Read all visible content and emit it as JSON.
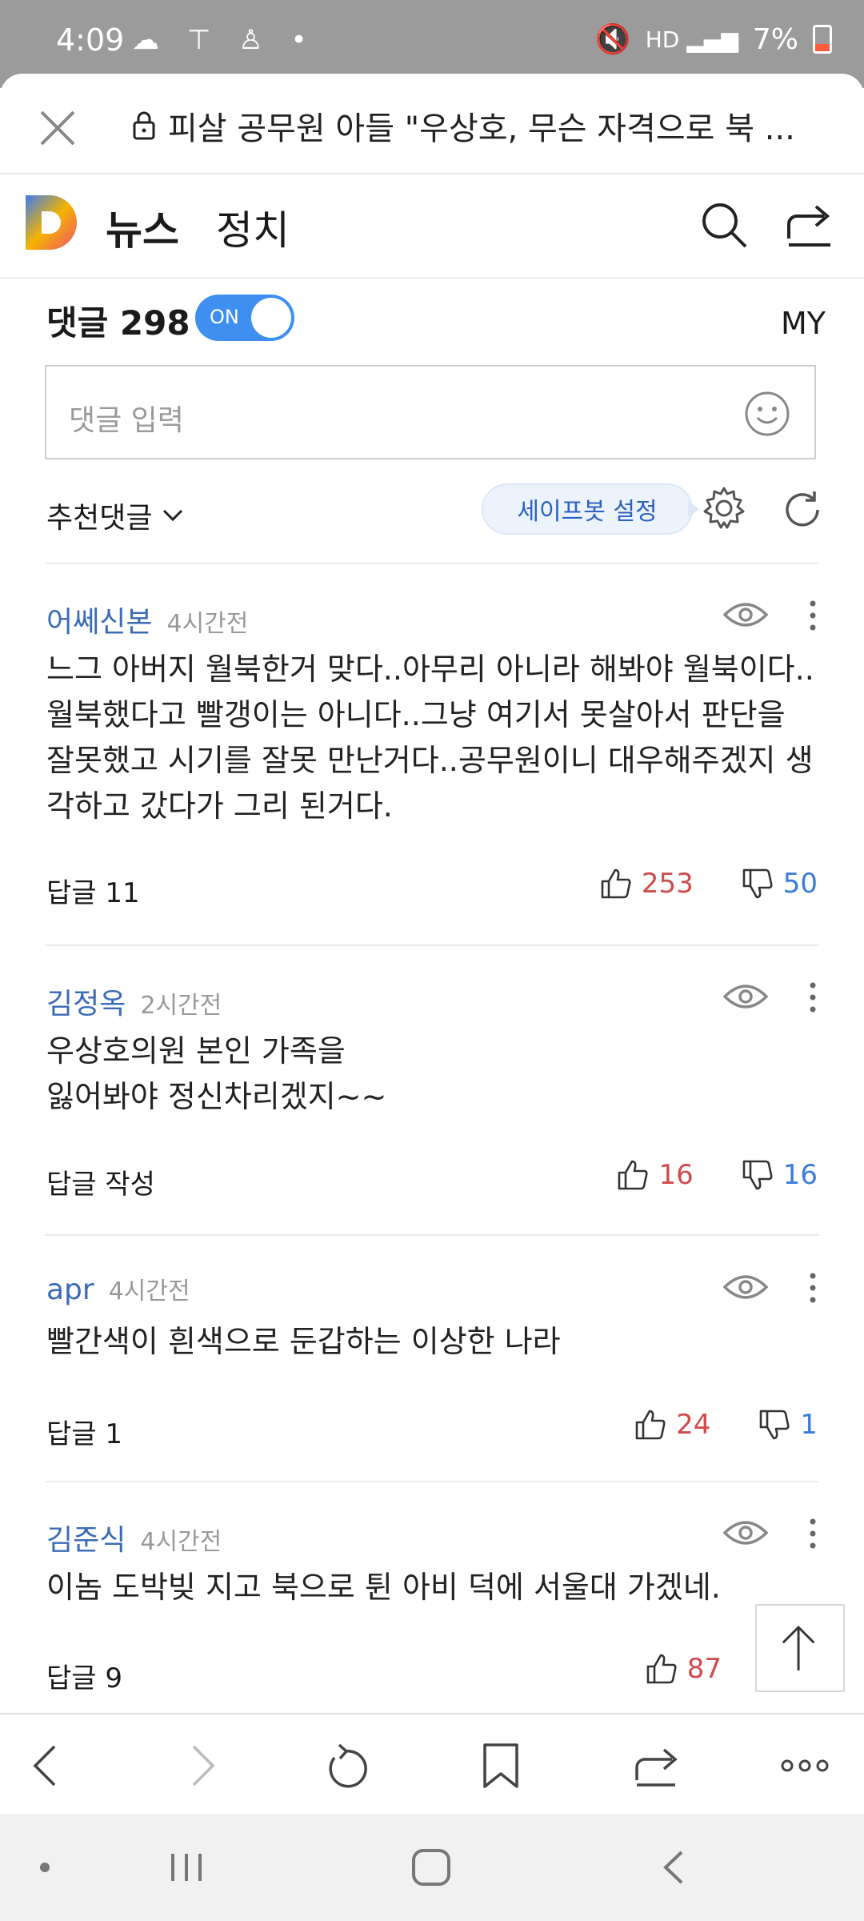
{
  "status": {
    "time": "4:09",
    "battery": "7%"
  },
  "browser": {
    "page_title": "피살 공무원 아들 \"우상호, 무슨 자격으로 북 ..."
  },
  "nav": {
    "news": "뉴스",
    "section": "정치"
  },
  "comments_header": {
    "label": "댓글 298",
    "toggle": "ON",
    "my": "MY"
  },
  "comment_input": {
    "placeholder": "댓글 입력"
  },
  "sort": {
    "label": "추천댓글",
    "safebot": "세이프봇 설정"
  },
  "comments": [
    {
      "author": "어쎄신본",
      "time": "4시간전",
      "text": "느그 아버지 월북한거 맞다..아무리 아니라 해봐야 월북이다.. 월북했다고 빨갱이는 아니다..그냥 여기서 못살아서 판단을 잘못했고 시기를 잘못 만난거다..공무원이니 대우해주겠지 생각하고 갔다가 그리 된거다.",
      "reply": "답글 11",
      "up": "253",
      "down": "50"
    },
    {
      "author": "김정옥",
      "time": "2시간전",
      "text": "우상호의원 본인 가족을\n잃어봐야 정신차리겠지~~",
      "reply": "답글 작성",
      "up": "16",
      "down": "16"
    },
    {
      "author": "apr",
      "time": "4시간전",
      "text": "빨간색이 흰색으로 둔갑하는 이상한 나라",
      "reply": "답글 1",
      "up": "24",
      "down": "1"
    },
    {
      "author": "김준식",
      "time": "4시간전",
      "text": "이놈 도박빚 지고 북으로 튄 아비 덕에 서울대 가겠네.",
      "reply": "답글 9",
      "up": "87",
      "down": ""
    }
  ],
  "colors": {
    "accent": "#3f8ff0",
    "author": "#3b6bb7",
    "up": "#d04b4b",
    "down": "#3a7cd9"
  }
}
